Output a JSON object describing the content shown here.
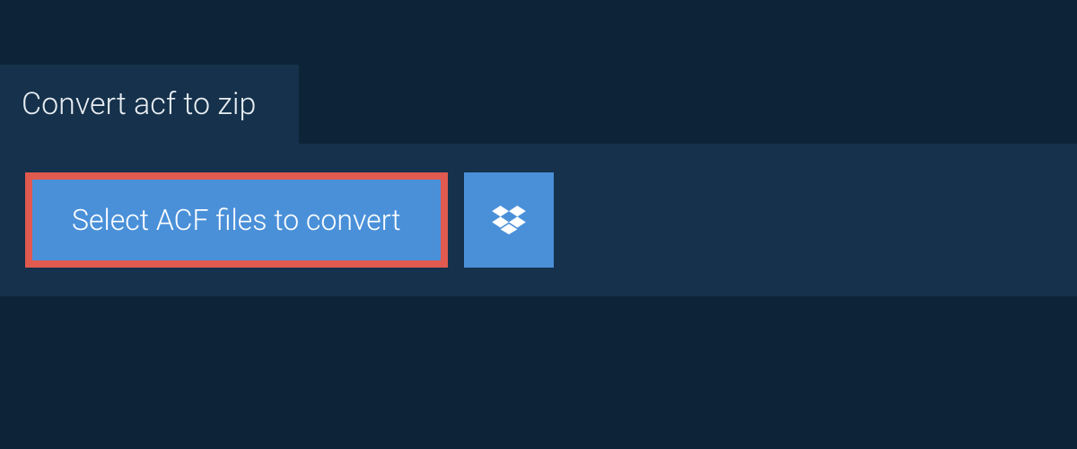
{
  "tab": {
    "title": "Convert acf to zip"
  },
  "actions": {
    "select_label": "Select ACF files to convert"
  },
  "colors": {
    "background": "#0d2438",
    "panel": "#15314b",
    "button": "#4a90d9",
    "highlight_border": "#e05a4f",
    "text_light": "#e8edf2",
    "text_white": "#ffffff"
  }
}
